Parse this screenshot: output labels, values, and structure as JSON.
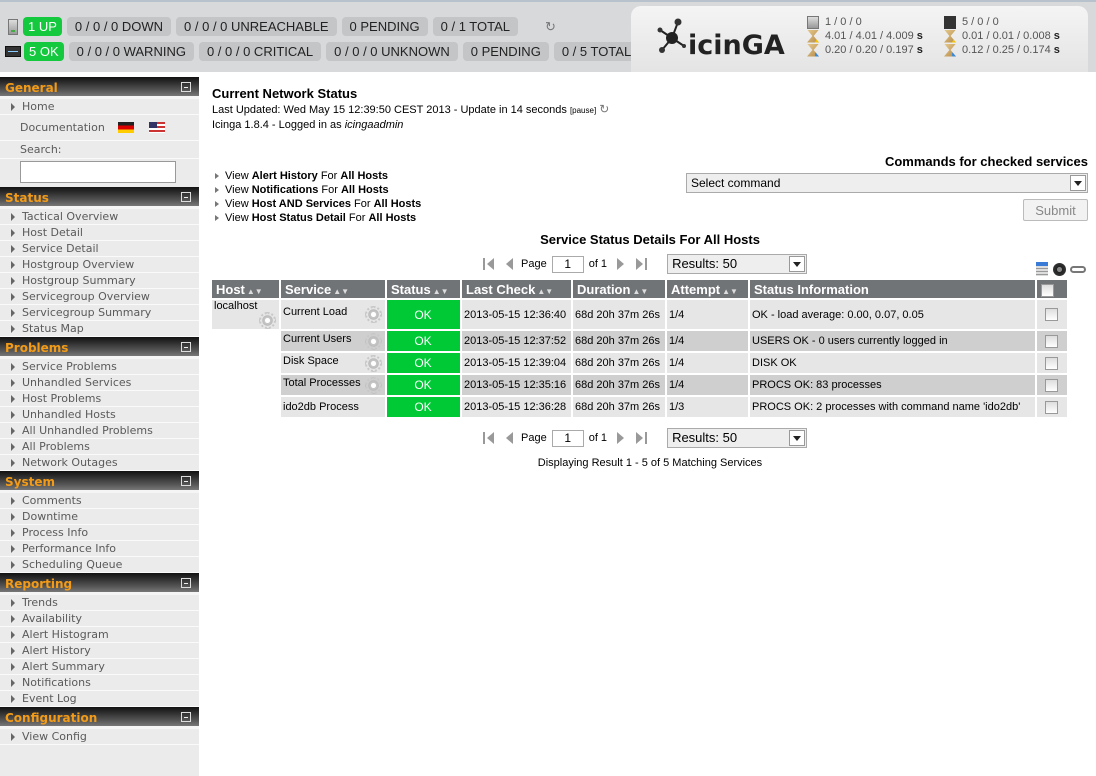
{
  "tactical": {
    "hosts": {
      "up": "1 UP",
      "down": "0 / 0 / 0 DOWN",
      "unreachable": "0 / 0 / 0 UNREACHABLE",
      "pending": "0 PENDING",
      "total": "0 / 1 TOTAL"
    },
    "services": {
      "ok": "5 OK",
      "warning": "0 / 0 / 0 WARNING",
      "critical": "0 / 0 / 0 CRITICAL",
      "unknown": "0 / 0 / 0 UNKNOWN",
      "pending": "0 PENDING",
      "total": "0 / 5 TOTAL"
    },
    "refresh_icon": "refresh-icon"
  },
  "logo": {
    "text": "icinGA"
  },
  "perf": {
    "hosts": {
      "counts": "1 / 0 / 0",
      "latency": "4.01 / 4.01 / 4.009",
      "exec": "0.20 / 0.20 / 0.197"
    },
    "services": {
      "counts": "5 / 0 / 0",
      "latency": "0.01 / 0.01 / 0.008",
      "exec": "0.12 / 0.25 / 0.174"
    },
    "unit": "s"
  },
  "sidebar": {
    "general": {
      "title": "General",
      "home": "Home",
      "documentation": "Documentation",
      "search_label": "Search:",
      "search_value": ""
    },
    "sections": [
      {
        "title": "Status",
        "items": [
          "Tactical Overview",
          "Host Detail",
          "Service Detail",
          "Hostgroup Overview",
          "Hostgroup Summary",
          "Servicegroup Overview",
          "Servicegroup Summary",
          "Status Map"
        ]
      },
      {
        "title": "Problems",
        "items": [
          "Service Problems",
          "Unhandled Services",
          "Host Problems",
          "Unhandled Hosts",
          "All Unhandled Problems",
          "All Problems",
          "Network Outages"
        ]
      },
      {
        "title": "System",
        "items": [
          "Comments",
          "Downtime",
          "Process Info",
          "Performance Info",
          "Scheduling Queue"
        ]
      },
      {
        "title": "Reporting",
        "items": [
          "Trends",
          "Availability",
          "Alert Histogram",
          "Alert History",
          "Alert Summary",
          "Notifications",
          "Event Log"
        ]
      },
      {
        "title": "Configuration",
        "items": [
          "View Config"
        ]
      }
    ]
  },
  "main": {
    "title": "Current Network Status",
    "last_updated": "Last Updated: Wed May 15 12:39:50 CEST 2013 - Update in 14 seconds",
    "pause": "[pause]",
    "version": "Icinga 1.8.4 - Logged in as",
    "user": "icingaadmin",
    "links": [
      {
        "pre": "View",
        "bold": "Alert History",
        "mid": "For",
        "target": "All Hosts"
      },
      {
        "pre": "View",
        "bold": "Notifications",
        "mid": "For",
        "target": "All Hosts"
      },
      {
        "pre": "View",
        "bold": "Host AND Services",
        "mid": "For",
        "target": "All Hosts"
      },
      {
        "pre": "View",
        "bold": "Host Status Detail",
        "mid": "For",
        "target": "All Hosts"
      }
    ],
    "commands": {
      "title": "Commands for checked services",
      "select_value": "Select command",
      "submit": "Submit"
    },
    "table_title": "Service Status Details For All Hosts",
    "pager": {
      "page_label": "Page",
      "page_value": "1",
      "of": "of 1",
      "results": "Results: 50"
    },
    "columns": [
      "Host",
      "Service",
      "Status",
      "Last Check",
      "Duration",
      "Attempt",
      "Status Information"
    ],
    "sort_glyph": "▲▼",
    "rows": [
      {
        "host": "localhost",
        "service": "Current Load",
        "status": "OK",
        "last_check": "2013-05-15 12:36:40",
        "duration": "68d 20h 37m 26s",
        "attempt": "1/4",
        "info": "OK - load average: 0.00, 0.07, 0.05"
      },
      {
        "host": "",
        "service": "Current Users",
        "status": "OK",
        "last_check": "2013-05-15 12:37:52",
        "duration": "68d 20h 37m 26s",
        "attempt": "1/4",
        "info": "USERS OK - 0 users currently logged in"
      },
      {
        "host": "",
        "service": "Disk Space",
        "status": "OK",
        "last_check": "2013-05-15 12:39:04",
        "duration": "68d 20h 37m 26s",
        "attempt": "1/4",
        "info": "DISK OK"
      },
      {
        "host": "",
        "service": "Total Processes",
        "status": "OK",
        "last_check": "2013-05-15 12:35:16",
        "duration": "68d 20h 37m 26s",
        "attempt": "1/4",
        "info": "PROCS OK: 83 processes"
      },
      {
        "host": "",
        "service": "ido2db Process",
        "status": "OK",
        "last_check": "2013-05-15 12:36:28",
        "duration": "68d 20h 37m 26s",
        "attempt": "1/3",
        "info": "PROCS OK: 2 processes with command name 'ido2db'"
      }
    ],
    "displaying": "Displaying Result 1 - 5 of 5 Matching Services"
  },
  "colors": {
    "ok_green": "#00c936",
    "pill_green": "#14c93d",
    "section_title": "#f39b17",
    "header_gray": "#717477"
  }
}
